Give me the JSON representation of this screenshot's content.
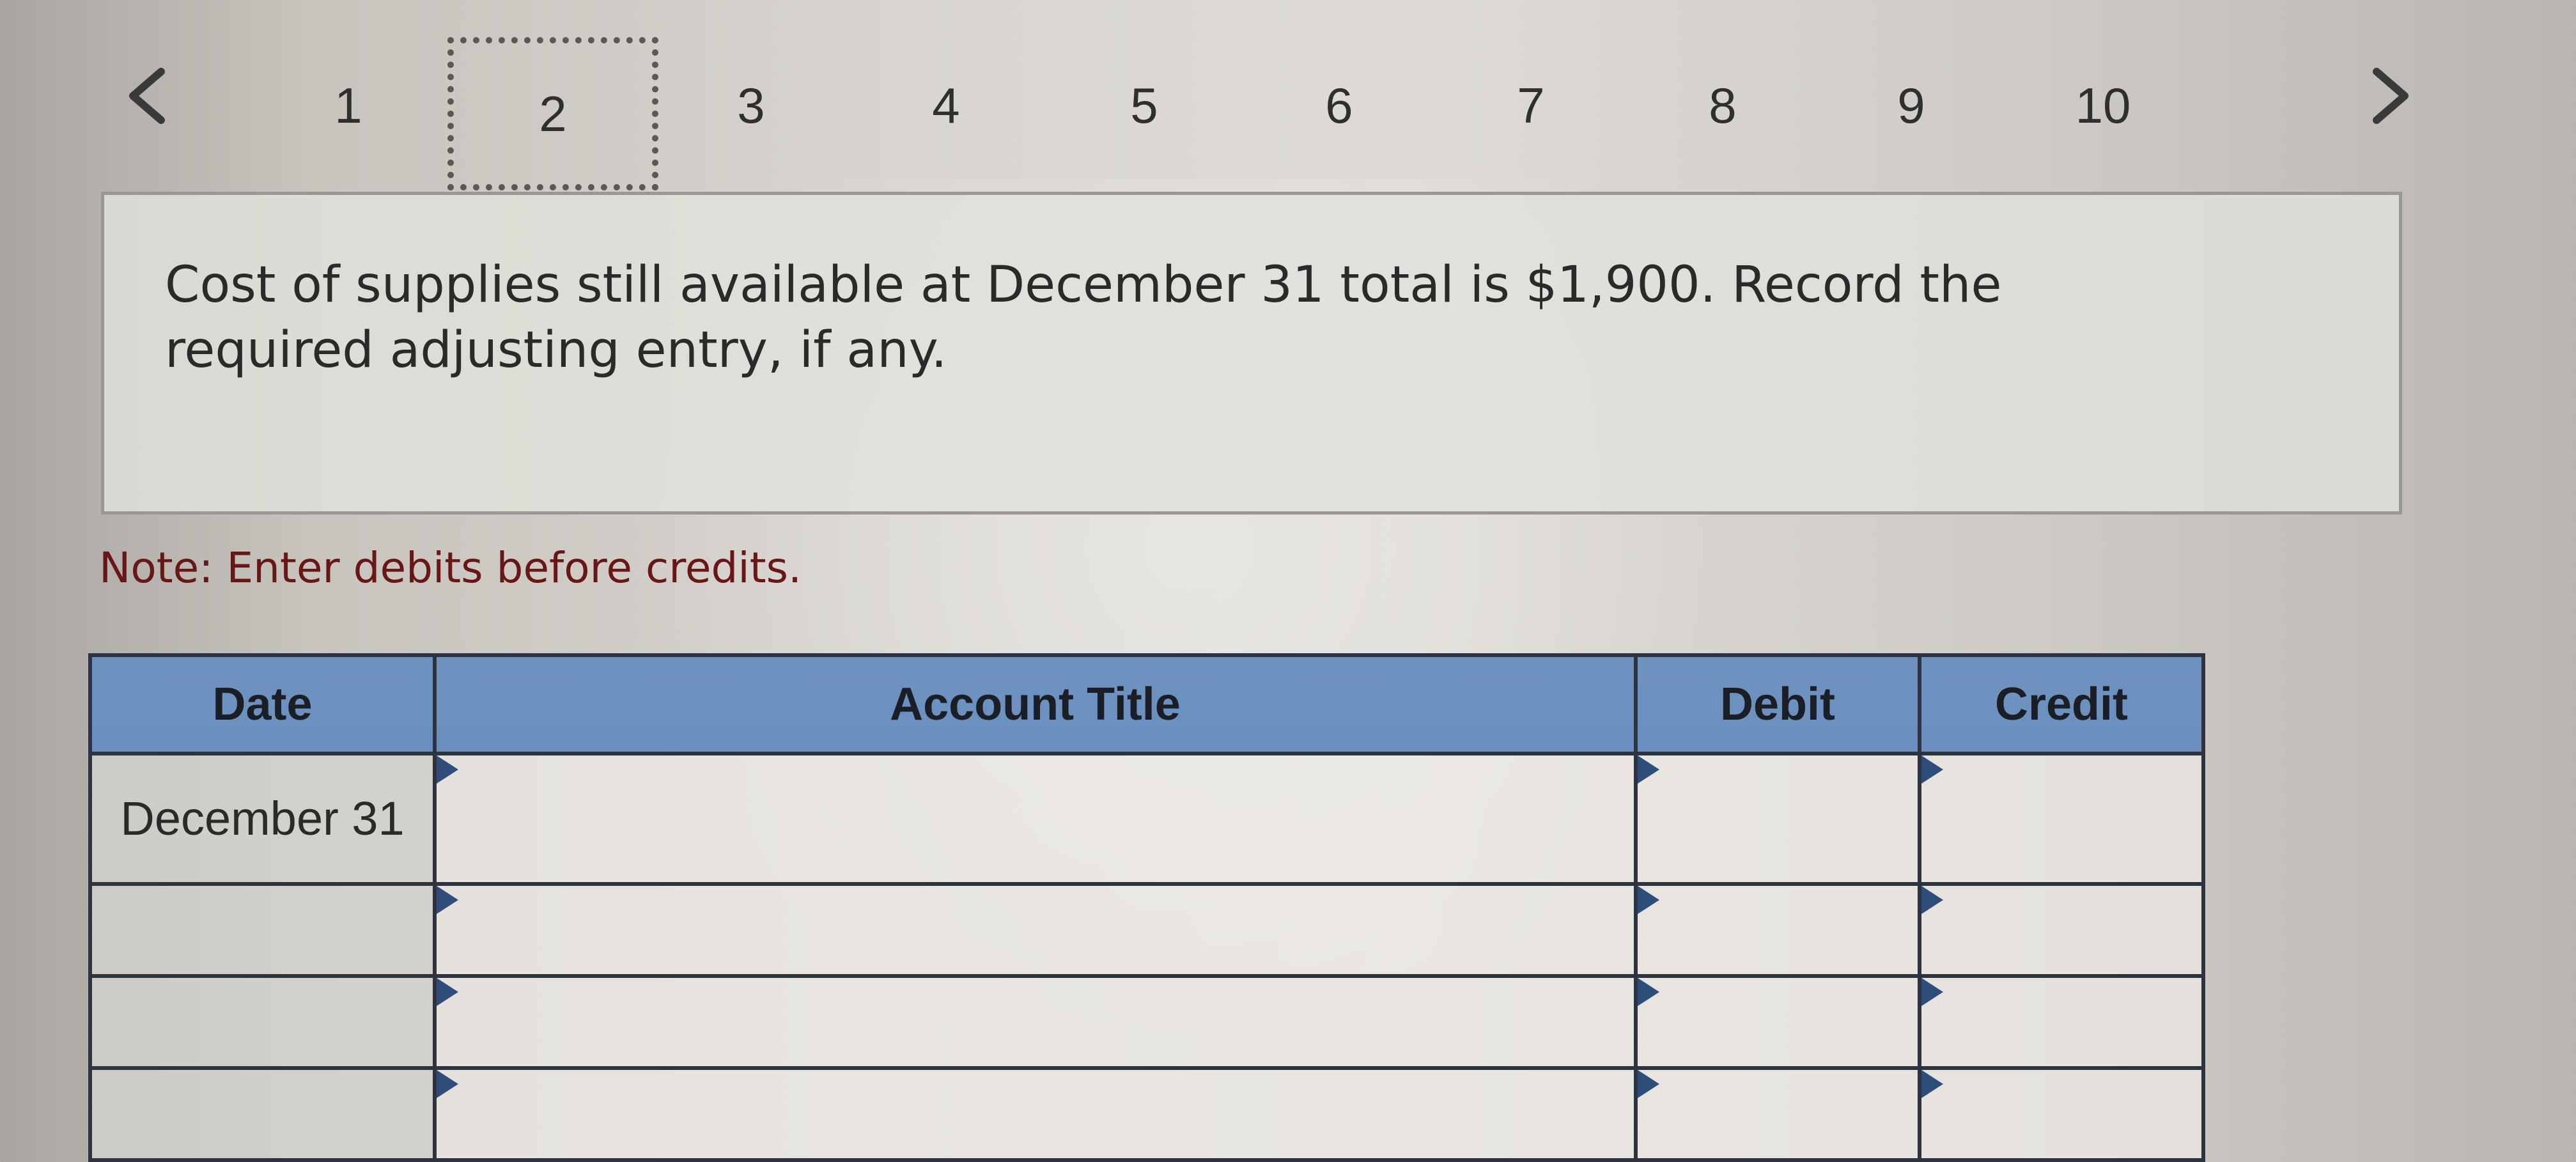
{
  "pager": {
    "prev_icon": "chevron-left-icon",
    "next_icon": "chevron-right-icon",
    "pages": [
      "1",
      "2",
      "3",
      "4",
      "5",
      "6",
      "7",
      "8",
      "9",
      "10"
    ],
    "current_page": "2"
  },
  "question": {
    "text": "Cost of supplies still available at December 31 total is $1,900. Record the required adjusting entry, if any."
  },
  "note": "Note: Enter debits before credits.",
  "journal": {
    "headers": {
      "date": "Date",
      "account": "Account Title",
      "debit": "Debit",
      "credit": "Credit"
    },
    "rows": [
      {
        "date": "December 31",
        "account": "",
        "debit": "",
        "credit": ""
      },
      {
        "date": "",
        "account": "",
        "debit": "",
        "credit": ""
      },
      {
        "date": "",
        "account": "",
        "debit": "",
        "credit": ""
      },
      {
        "date": "",
        "account": "",
        "debit": "",
        "credit": ""
      }
    ]
  },
  "colors": {
    "header_blue": "#6f92bf",
    "note_red": "#6b1616",
    "grid_dark": "#2d3440"
  }
}
